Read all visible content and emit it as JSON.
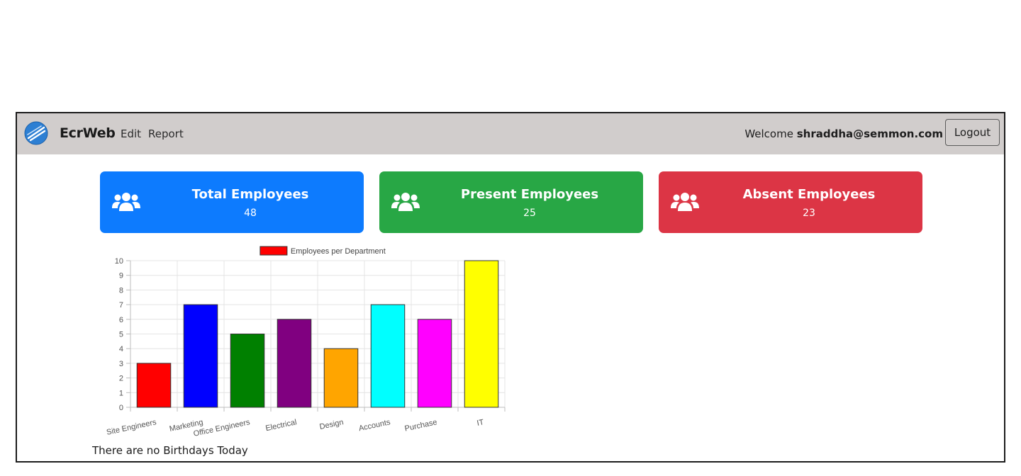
{
  "navbar": {
    "brand": "EcrWeb",
    "links": [
      {
        "label": "Edit"
      },
      {
        "label": "Report"
      }
    ],
    "welcome_prefix": "Welcome",
    "user": "shraddha@semmon.com",
    "logout_label": "Logout",
    "logo_icon": "ecrweb-logo-icon"
  },
  "cards": [
    {
      "title": "Total Employees",
      "value": "48",
      "color": "#0d7bfe",
      "icon": "users-icon"
    },
    {
      "title": "Present Employees",
      "value": "25",
      "color": "#28a745",
      "icon": "users-icon"
    },
    {
      "title": "Absent Employees",
      "value": "23",
      "color": "#dc3545",
      "icon": "users-icon"
    }
  ],
  "chart_data": {
    "type": "bar",
    "title": "",
    "xlabel": "",
    "ylabel": "",
    "legend": {
      "position": "top",
      "label": "Employees per Department",
      "color": "#ff0000"
    },
    "categories": [
      "Site Engineers",
      "Marketing",
      "Office Engineers",
      "Electrical",
      "Design",
      "Accounts",
      "Purchase",
      "IT"
    ],
    "values": [
      3,
      7,
      5,
      6,
      4,
      7,
      6,
      10
    ],
    "colors": [
      "#ff0000",
      "#0000ff",
      "#008000",
      "#800080",
      "#ffa500",
      "#00ffff",
      "#ff00ff",
      "#ffff00"
    ],
    "ylim": [
      0,
      10
    ],
    "yticks": [
      0,
      1,
      2,
      3,
      4,
      5,
      6,
      7,
      8,
      9,
      10
    ],
    "grid": true
  },
  "birthday_message": "There are no Birthdays Today"
}
